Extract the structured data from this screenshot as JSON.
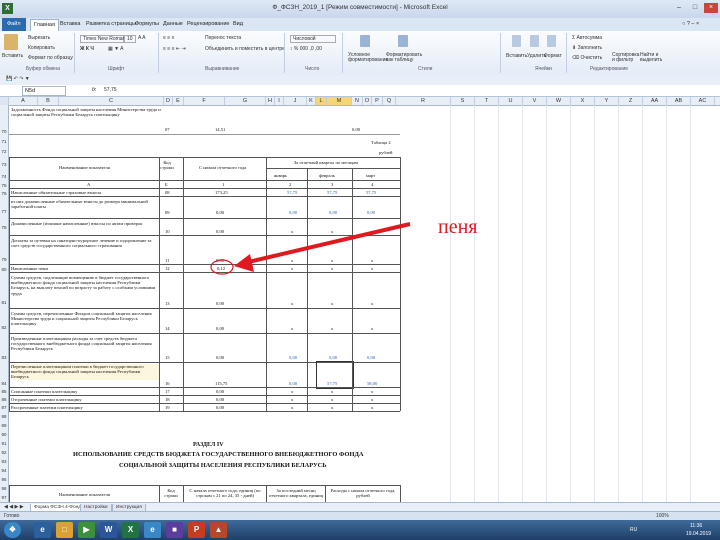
{
  "window": {
    "title": "Ф_ФСЗН_2019_1 [Режим совместимости] - Microsoft Excel",
    "app_icon": "X"
  },
  "ribbon_tabs": [
    "Файл",
    "Главная",
    "Вставка",
    "Разметка страницы",
    "Формулы",
    "Данные",
    "Рецензирование",
    "Вид"
  ],
  "ribbon": {
    "paste": "Вставить",
    "cut": "Вырезать",
    "copy": "Копировать",
    "format_painter": "Формат по образцу",
    "font_name": "Times New Roman",
    "font_size": "10",
    "wrap": "Перенос текста",
    "merge": "Объединить и поместить в центре",
    "number_format": "Числовой",
    "cond_format": "Условное форматирование",
    "table_format": "Форматировать как таблицу",
    "insert": "Вставить",
    "delete": "Удалить",
    "format": "Формат",
    "autosum": "Автосумма",
    "fill": "Заполнить",
    "clear": "Очистить",
    "sort": "Сортировка и фильтр",
    "find": "Найти и выделить",
    "groups": [
      "Буфер обмена",
      "Шрифт",
      "Выравнивание",
      "Число",
      "Стили",
      "Ячейки",
      "Редактирование"
    ]
  },
  "formula_bar": {
    "name_box": "N5d",
    "fx": "fx",
    "value": "57,75"
  },
  "columns": [
    "A",
    "B",
    "C",
    "D",
    "E",
    "F",
    "G",
    "H",
    "I",
    "J",
    "K",
    "L",
    "M",
    "N",
    "O",
    "P",
    "Q",
    "R",
    "S",
    "T",
    "U",
    "V",
    "W",
    "X",
    "Y",
    "Z",
    "AA",
    "AB",
    "AC"
  ],
  "rows": {
    "r70": {
      "num": "70",
      "text": "Задолженность Фонда социальной защиты населения Министерства труда и социальной защиты Республики Беларусь плательщику",
      "code": "07",
      "f": "14,51",
      "m": "0,00"
    },
    "r71": {
      "num": "71",
      "right": "Таблица 2"
    },
    "r72": {
      "num": "72",
      "right": "рублей"
    },
    "r73": {
      "num": "73",
      "h_name": "Наименование показателя",
      "h_code": "Код строки",
      "h_start": "С начала отчетного года",
      "h_quarter": "За отчетный квартал по месяцам"
    },
    "r74": {
      "num": "74",
      "m1": "январь",
      "m2": "февраль",
      "m3": "март"
    },
    "r75": {
      "num": "75",
      "a": "А",
      "b": "Б",
      "c1": "1",
      "c2": "2",
      "c3": "3",
      "c4": "4"
    },
    "r76": {
      "num": "76",
      "text": "Начисленные обязательные страховые взносы",
      "code": "08",
      "f": "173,25",
      "j": "57,75",
      "l": "57,75",
      "n": "57,75"
    },
    "r77": {
      "num": "77",
      "text": "из них доначисленные обязательные взносы до размера минимальной заработной платы",
      "code": "09",
      "f": "0,00",
      "j": "0,00",
      "l": "0,00",
      "n": "0,00"
    },
    "r78": {
      "num": "78",
      "text": "Доначисленные (излишне начисленные) взносы по актам проверок",
      "code": "10",
      "f": "0,00",
      "j": "х",
      "l": "х",
      "n": "х"
    },
    "r79": {
      "num": "79",
      "text": "Доплаты за путевки на санаторно-курортное лечение и оздоровление за счет средств государственного социального страхования",
      "code": "11",
      "f": "0,00",
      "j": "х",
      "l": "х",
      "n": "х"
    },
    "r80": {
      "num": "80",
      "text": "Начисленные пени",
      "code": "12",
      "f": "0,12",
      "j": "х",
      "l": "х",
      "n": "х"
    },
    "r81": {
      "num": "81",
      "text": "Суммы средств, подлежащие возмещению в бюджет государственного внебюджетного фонда социальной защиты населения Республики Беларусь, на выплату пенсий по возрасту за работу с особыми условиями труда",
      "code": "13",
      "f": "0,00",
      "j": "х",
      "l": "х",
      "n": "х"
    },
    "r82": {
      "num": "82",
      "text": "Суммы средств, перечисленные Фондом социальной защиты населения Министерства труда и социальной защиты Республики Беларусь плательщику",
      "code": "14",
      "f": "0,00",
      "j": "х",
      "l": "х",
      "n": "х"
    },
    "r83": {
      "num": "83",
      "text": "Произведенные плательщиком расходы за счет средств бюджета государственного внебюджетного фонда социальной защиты населения Республики Беларусь",
      "code": "15",
      "f": "0,00",
      "j": "0,00",
      "l": "0,00",
      "n": "0,00"
    },
    "r84": {
      "num": "84",
      "text": "Перечисленные плательщиком платежи в бюджет государственного внебюджетного фонда социальной защиты населения Республики Беларусь",
      "code": "16",
      "f": "115,75",
      "j": "0,00",
      "l": "57,75",
      "n": "58,00"
    },
    "r85": {
      "num": "85",
      "text": "Списанные платежи плательщику",
      "code": "17",
      "f": "0,00",
      "j": "х",
      "l": "х",
      "n": "х"
    },
    "r86": {
      "num": "86",
      "text": "Отсроченные платежи плательщику",
      "code": "18",
      "f": "0,00",
      "j": "х",
      "l": "х",
      "n": "х"
    },
    "r87": {
      "num": "87",
      "text": "Рассроченные платежи плательщику",
      "code": "19",
      "f": "0,00",
      "j": "х",
      "l": "х",
      "n": "х"
    },
    "empty": [
      "88",
      "89",
      "90",
      "91",
      "92"
    ],
    "r93": {
      "num": "93",
      "heading": "РАЗДЕЛ IV"
    },
    "r94": {
      "num": "94",
      "heading": "ИСПОЛЬЗОВАНИЕ СРЕДСТВ БЮДЖЕТА ГОСУДАРСТВЕННОГО ВНЕБЮДЖЕТНОГО ФОНДА"
    },
    "r95": {
      "num": "95",
      "heading": "СОЦИАЛЬНОЙ ЗАЩИТЫ НАСЕЛЕНИЯ РЕСПУБЛИКИ БЕЛАРУСЬ"
    },
    "r96": {
      "num": "96"
    },
    "r97": {
      "num": "97",
      "h_name": "Наименование показателя",
      "h_code": "Код строки",
      "h_start": "С начала отчетного года, единиц (по строкам с 21 по 24, 35 - дней)",
      "h_last": "За последний месяц отчетного квартала, единиц",
      "h_expense": "Расходы с начала отчетного года, рублей"
    }
  },
  "annotation": "пеня",
  "sheet_tabs": [
    "Форма ФСЗН 4-Фонд",
    "Настройки",
    "Инструкция"
  ],
  "status": {
    "left": "Готово",
    "zoom": "100%"
  },
  "taskbar": {
    "lang": "RU",
    "time": "11:36",
    "date": "19.04.2019"
  }
}
